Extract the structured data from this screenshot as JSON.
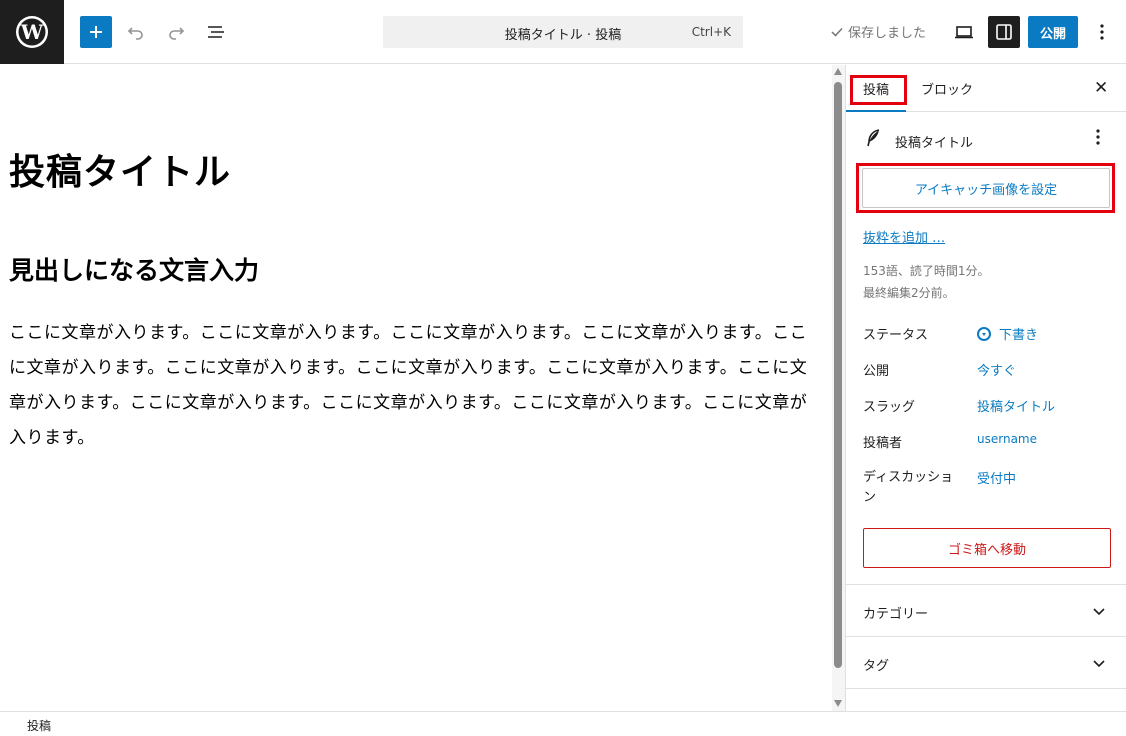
{
  "topbar": {
    "command_title": "投稿タイトル · 投稿",
    "command_shortcut": "Ctrl+K",
    "saved_label": "保存しました",
    "publish_label": "公開"
  },
  "editor": {
    "post_title": "投稿タイトル",
    "heading": "見出しになる文言入力",
    "paragraph": "ここに文章が入ります。ここに文章が入ります。ここに文章が入ります。ここに文章が入ります。ここに文章が入ります。ここに文章が入ります。ここに文章が入ります。ここに文章が入ります。ここに文章が入ります。ここに文章が入ります。ここに文章が入ります。ここに文章が入ります。ここに文章が入ります。"
  },
  "sidebar": {
    "tabs": [
      {
        "label": "投稿"
      },
      {
        "label": "ブロック"
      }
    ],
    "document_title": "投稿タイトル",
    "featured_image_label": "アイキャッチ画像を設定",
    "excerpt_label": "抜粋を追加 …",
    "word_count": "153語、読了時間1分。",
    "last_edited": "最終編集2分前。",
    "rows": [
      {
        "label": "ステータス",
        "value": "下書き"
      },
      {
        "label": "公開",
        "value": "今すぐ"
      },
      {
        "label": "スラッグ",
        "value": "投稿タイトル"
      },
      {
        "label": "投稿者",
        "value": "username"
      },
      {
        "label": "ディスカッション",
        "value": "受付中"
      }
    ],
    "trash_label": "ゴミ箱へ移動",
    "panels": [
      {
        "label": "カテゴリー"
      },
      {
        "label": "タグ"
      }
    ]
  },
  "footer": {
    "breadcrumb": "投稿"
  },
  "colors": {
    "accent": "#0a7bc2",
    "highlight": "#e3000f",
    "danger": "#cc1818"
  }
}
